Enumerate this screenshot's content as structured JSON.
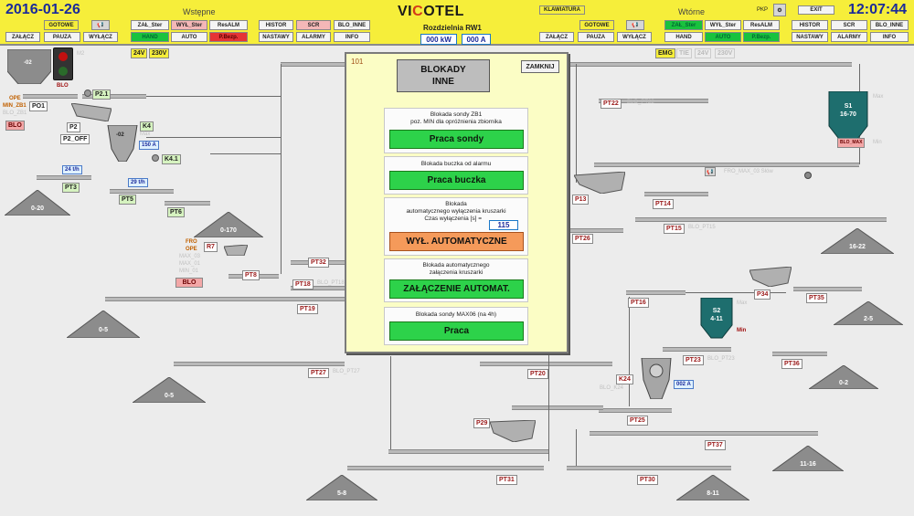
{
  "header": {
    "date": "2016-01-26",
    "time": "12:07:44",
    "brand_prefix": "VI",
    "brand_o": "C",
    "brand_suffix": "OTEL",
    "left_section": "Wstępne",
    "right_section": "Wtórne",
    "center_title": "Rozdzielnia RW1",
    "power": "000 kW",
    "current": "000 A",
    "keyboard_button": "KLAWIATURA",
    "pkp_label": "PKP",
    "exit_button": "EXIT",
    "left": {
      "gotowe": "GOTOWE",
      "zal_ster": "ZAŁ_Ster",
      "wyl_ster": "WYŁ_Ster",
      "resalm": "ResALM",
      "hand": "HAND",
      "auto": "AUTO",
      "pbezp": "P.Bezp.",
      "zalacz": "ZAŁĄCZ",
      "pauza": "PAUZA",
      "wylacz": "WYŁĄCZ",
      "histor": "HISTOR",
      "scr": "SCR",
      "blo_inne": "BLO_INNE",
      "nastawy": "NASTAWY",
      "alarmy": "ALARMY",
      "info": "INFO"
    },
    "right": {
      "gotowe": "GOTOWE",
      "zal_ster": "ZAŁ_Ster",
      "wyl_ster": "WYŁ_Ster",
      "resalm": "ResALM",
      "hand": "HAND",
      "auto": "AUTO",
      "pbezp": "P.Bezp.",
      "zalacz": "ZAŁĄCZ",
      "pauza": "PAUZA",
      "wylacz": "WYŁĄCZ",
      "histor": "HISTOR",
      "scr": "SCR",
      "blo_inne": "BLO_INNE",
      "nastawy": "NASTAWY",
      "alarmy": "ALARMY",
      "info": "INFO"
    }
  },
  "voltages": {
    "left_24v": "24V",
    "left_230v": "230V",
    "emg": "EMG",
    "tie": "TIE",
    "right_24v": "24V",
    "right_230v": "230V"
  },
  "dialog": {
    "number": "101",
    "title_line1": "BLOKADY",
    "title_line2": "INNE",
    "close_button": "ZAMKNIJ",
    "panel1_line1": "Blokada sondy ZB1",
    "panel1_line2": "poz. MIN dla opróżnienia zbiornika",
    "panel1_button": "Praca sondy",
    "panel2_line1": "Blokada buczka od alarmu",
    "panel2_button": "Praca buczka",
    "panel3_line1": "Blokada",
    "panel3_line2": "automatycznego wyłączenia kruszarki",
    "panel3_line3": "Czas wyłączenia [s] =",
    "panel3_value": "115",
    "panel3_button": "WYŁ. AUTOMATYCZNE",
    "panel4_line1": "Blokada automatycznego",
    "panel4_line2": "załączenia kruszarki",
    "panel4_button": "ZAŁĄCZENIE AUTOMAT.",
    "panel5_line1": "Blokada sondy MAX06 (na 4h)",
    "panel5_button": "Praca"
  },
  "plant": {
    "hopper_02": "-02",
    "blo_lamp": "BLO",
    "m2": "M2",
    "ope": "OPE",
    "min_zb1": "MIN_ZB1",
    "blo_zb1": "BLO_ZB1",
    "blo_red1": "BLO",
    "po1": "PO1",
    "p21": "P2.1",
    "p2": "P2",
    "p2_off": "P2_OFF",
    "k4": "K4",
    "max": "Max",
    "crusher_02": "-02",
    "flow_150": "150 A",
    "k41": "K4.1",
    "flow_24": "24 t/h",
    "flow_29": "29 t/h",
    "pt3": "PT3",
    "pt5": "PT5",
    "pt6": "PT6",
    "pile_020": "0-20",
    "pile_0170": "0-170",
    "fro": "FRO",
    "ope2": "OPE",
    "max03": "MAX_03",
    "max01": "MAX_01",
    "min01": "MIN_01",
    "blo_red2": "BLO",
    "r7": "R7",
    "pt8": "PT8",
    "pt32": "PT32",
    "pt18": "PT18",
    "blo_pt18": "BLO_PT18",
    "pt19": "PT19",
    "pile_05a": "0-5",
    "pile_05b": "0-5",
    "pt27": "PT27",
    "blo_pt27": "BLO_PT27",
    "pile_58": "5-8",
    "pt22": "PT22",
    "blo_pt22": "BLO_PT22",
    "s1": "S1",
    "s1_range": "16-70",
    "blo_max": "BLO_MAX",
    "s1_max": "Max",
    "s1_min": "Min",
    "pt14": "PT14",
    "fro_max": "FRO_MAX_03 Słów",
    "p13": "P13",
    "pt15": "PT15",
    "blo_pt15": "BLO_PT15",
    "pt26": "PT26",
    "pile_1622": "16-22",
    "p34": "P34",
    "pt35": "PT35",
    "pt16": "PT16",
    "s2": "S2",
    "s2_range": "4-11",
    "s2_min": "Min",
    "s2_max": "Max",
    "pile_25": "2-5",
    "pt23": "PT23",
    "blo_pt23": "BLO_PT23",
    "pt36": "PT36",
    "pt20": "PT20",
    "k24": "K24",
    "blo_k24": "BLO_K24",
    "flow_002": "002 A",
    "pile_02": "0-2",
    "pt25": "PT25",
    "p29": "P29",
    "pt37": "PT37",
    "pile_1116": "11-16",
    "pt31": "PT31",
    "pt30": "PT30",
    "pile_811": "8-11"
  },
  "colors": {
    "header": "#f6ee3a",
    "dialog": "#fbfdc5",
    "button_green": "#2dd24a",
    "button_orange": "#f59a5a",
    "pile": "#8c8c8c",
    "silo": "#1e6e6e"
  }
}
